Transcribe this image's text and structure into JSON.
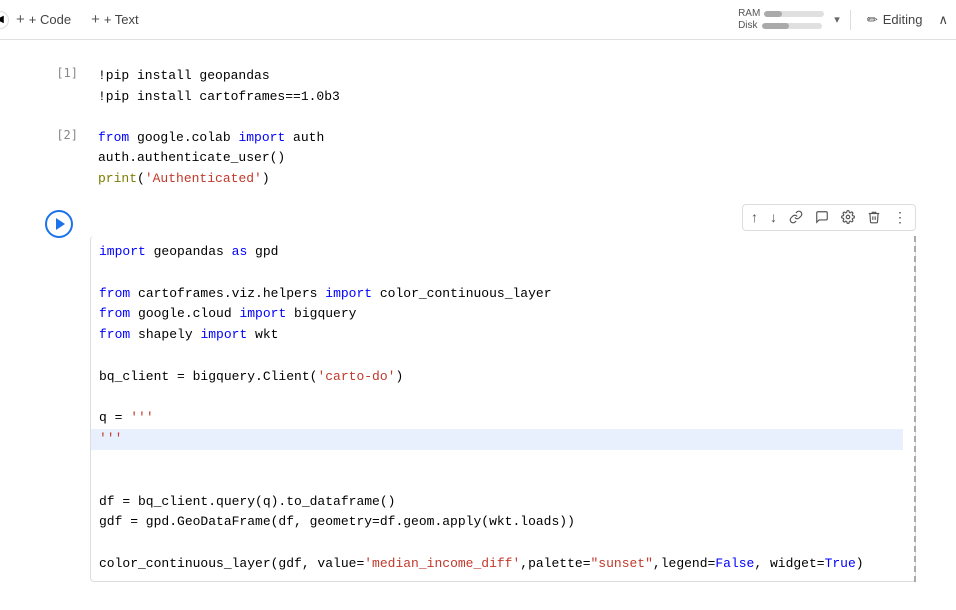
{
  "toolbar": {
    "add_code_label": "+ Code",
    "add_text_label": "+ Text",
    "ram_label": "RAM",
    "disk_label": "Disk",
    "ram_percent": 30,
    "disk_percent": 45,
    "editing_label": "Editing"
  },
  "cells": [
    {
      "id": "cell-1",
      "number": "[1]",
      "type": "code",
      "lines": [
        {
          "text": "!pip install geopandas"
        },
        {
          "text": "!pip install cartoframes==1.0b3"
        }
      ]
    },
    {
      "id": "cell-2",
      "number": "[2]",
      "type": "code",
      "lines": [
        {
          "text": "from google.colab import auth"
        },
        {
          "text": "auth.authenticate_user()"
        },
        {
          "text": "print('Authenticated')"
        }
      ]
    },
    {
      "id": "cell-3",
      "number": "",
      "type": "code-active",
      "lines": [
        {
          "text": "import geopandas as gpd"
        },
        {
          "text": ""
        },
        {
          "text": "from cartoframes.viz.helpers import color_continuous_layer"
        },
        {
          "text": "from google.cloud import bigquery"
        },
        {
          "text": "from shapely import wkt"
        },
        {
          "text": ""
        },
        {
          "text": "bq_client = bigquery.Client('carto-do')"
        },
        {
          "text": ""
        },
        {
          "text": "q = '''"
        },
        {
          "text": "'''",
          "highlight": true
        },
        {
          "text": ""
        },
        {
          "text": "df = bq_client.query(q).to_dataframe()"
        },
        {
          "text": "gdf = gpd.GeoDataFrame(df, geometry=df.geom.apply(wkt.loads))"
        },
        {
          "text": ""
        },
        {
          "text": "color_continuous_layer(gdf, value='median_income_diff',palette=\"sunset\",legend=False, widget=True)"
        }
      ]
    }
  ],
  "cell_toolbar": {
    "move_up": "↑",
    "move_down": "↓",
    "link": "🔗",
    "comment": "💬",
    "settings": "⚙",
    "delete": "🗑",
    "more": "⋮"
  }
}
